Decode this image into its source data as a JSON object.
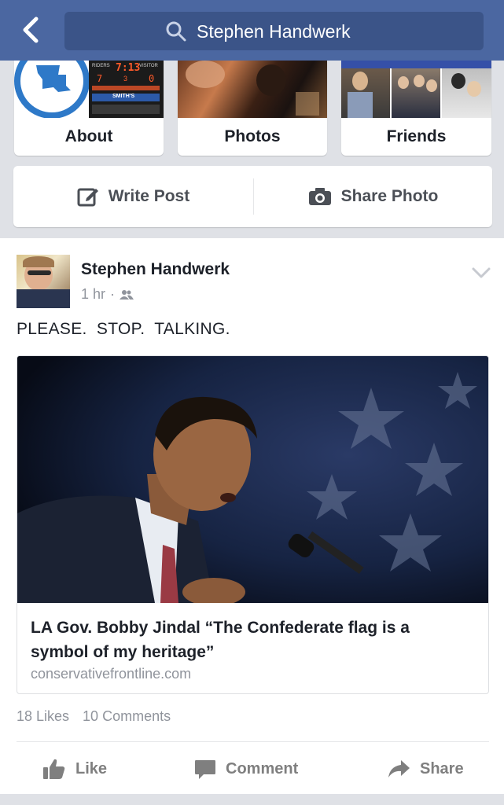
{
  "header": {
    "search_text": "Stephen Handwerk"
  },
  "tiles": [
    {
      "label": "About"
    },
    {
      "label": "Photos"
    },
    {
      "label": "Friends"
    }
  ],
  "scoreboard": {
    "home_label": "RIDERS",
    "visitor_label": "VISITOR",
    "clock": "7:13",
    "home_score": "7",
    "visitor_score": "0",
    "quarter": "3",
    "sponsor": "SMITH'S"
  },
  "actions": {
    "write_post": "Write Post",
    "share_photo": "Share Photo"
  },
  "post": {
    "author": "Stephen Handwerk",
    "time": "1 hr",
    "separator": "·",
    "text": "PLEASE.  STOP.  TALKING.",
    "link": {
      "title": "LA Gov. Bobby Jindal “The Confederate flag is a symbol of my heritage”",
      "domain": "conservativefrontline.com"
    },
    "likes": "18 Likes",
    "comments": "10 Comments"
  },
  "reactions": {
    "like": "Like",
    "comment": "Comment",
    "share": "Share"
  },
  "colors": {
    "brand_blue": "#4b67a1",
    "search_bg": "#3b5488"
  }
}
